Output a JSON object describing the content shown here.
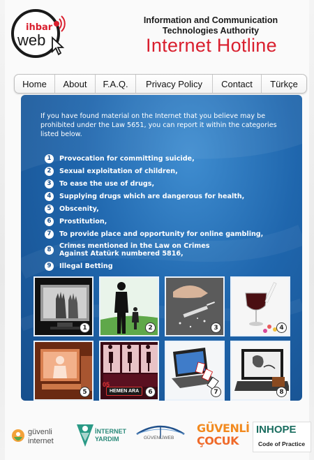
{
  "header": {
    "logo_top": "ihbar",
    "logo_bottom": "web",
    "authority_line1": "Information and Communication",
    "authority_line2": "Technologies  Authority",
    "hotline_title": "Internet Hotline"
  },
  "nav": {
    "items": [
      {
        "label": "Home"
      },
      {
        "label": "About"
      },
      {
        "label": "F.A.Q."
      },
      {
        "label": "Privacy Policy"
      },
      {
        "label": "Contact"
      },
      {
        "label": "Türkçe"
      }
    ]
  },
  "main": {
    "intro": "If you have found material on the Internet that you believe may be prohibited under the Law 5651, you can report it within the categories listed below.",
    "categories": [
      {
        "num": "1",
        "label": "Provocation for committing suicide,"
      },
      {
        "num": "2",
        "label": "Sexual exploitation of children,"
      },
      {
        "num": "3",
        "label": "To ease the use of drugs,"
      },
      {
        "num": "4",
        "label": "Supplying drugs which are dangerous for health,"
      },
      {
        "num": "5",
        "label": "Obscenity,"
      },
      {
        "num": "6",
        "label": "Prostitution,"
      },
      {
        "num": "7",
        "label": "To provide place and opportunity for online gambling,"
      },
      {
        "num": "8",
        "label": "Crimes mentioned in the Law on Crimes Against Atatürk numbered 5816,"
      },
      {
        "num": "9",
        "label": "Illegal Betting"
      }
    ],
    "thumbnails": [
      {
        "num": "1",
        "icon": "hands-screen-image"
      },
      {
        "num": "2",
        "icon": "man-child-image"
      },
      {
        "num": "3",
        "icon": "drugs-syringe-image"
      },
      {
        "num": "4",
        "icon": "wine-pills-image"
      },
      {
        "num": "5",
        "icon": "computer-figure-image"
      },
      {
        "num": "6",
        "icon": "silhouettes-image"
      },
      {
        "num": "7",
        "icon": "laptop-cards-image"
      },
      {
        "num": "8",
        "icon": "laptop-ataturk-image"
      }
    ],
    "thumb6_badge": "HEMEN ARA",
    "thumb6_number": "05"
  },
  "footer": {
    "guvenli_internet_line1": "güvenli",
    "guvenli_internet_line2": "internet",
    "internet_yardim_line1": "İNTERNET",
    "internet_yardim_line2": "YARDIM",
    "guvenli_web": "GÜVENLİWEB",
    "guvenli_cocuk_line1": "GÜVENLİ",
    "guvenli_cocuk_line2": "ÇOCUK",
    "inhope_title": "INHOPE",
    "inhope_sub": "Code of Practice"
  },
  "colors": {
    "accent_red": "#d91f2e",
    "panel_blue": "#1f66ad",
    "inhope_green": "#1a6d5f"
  }
}
